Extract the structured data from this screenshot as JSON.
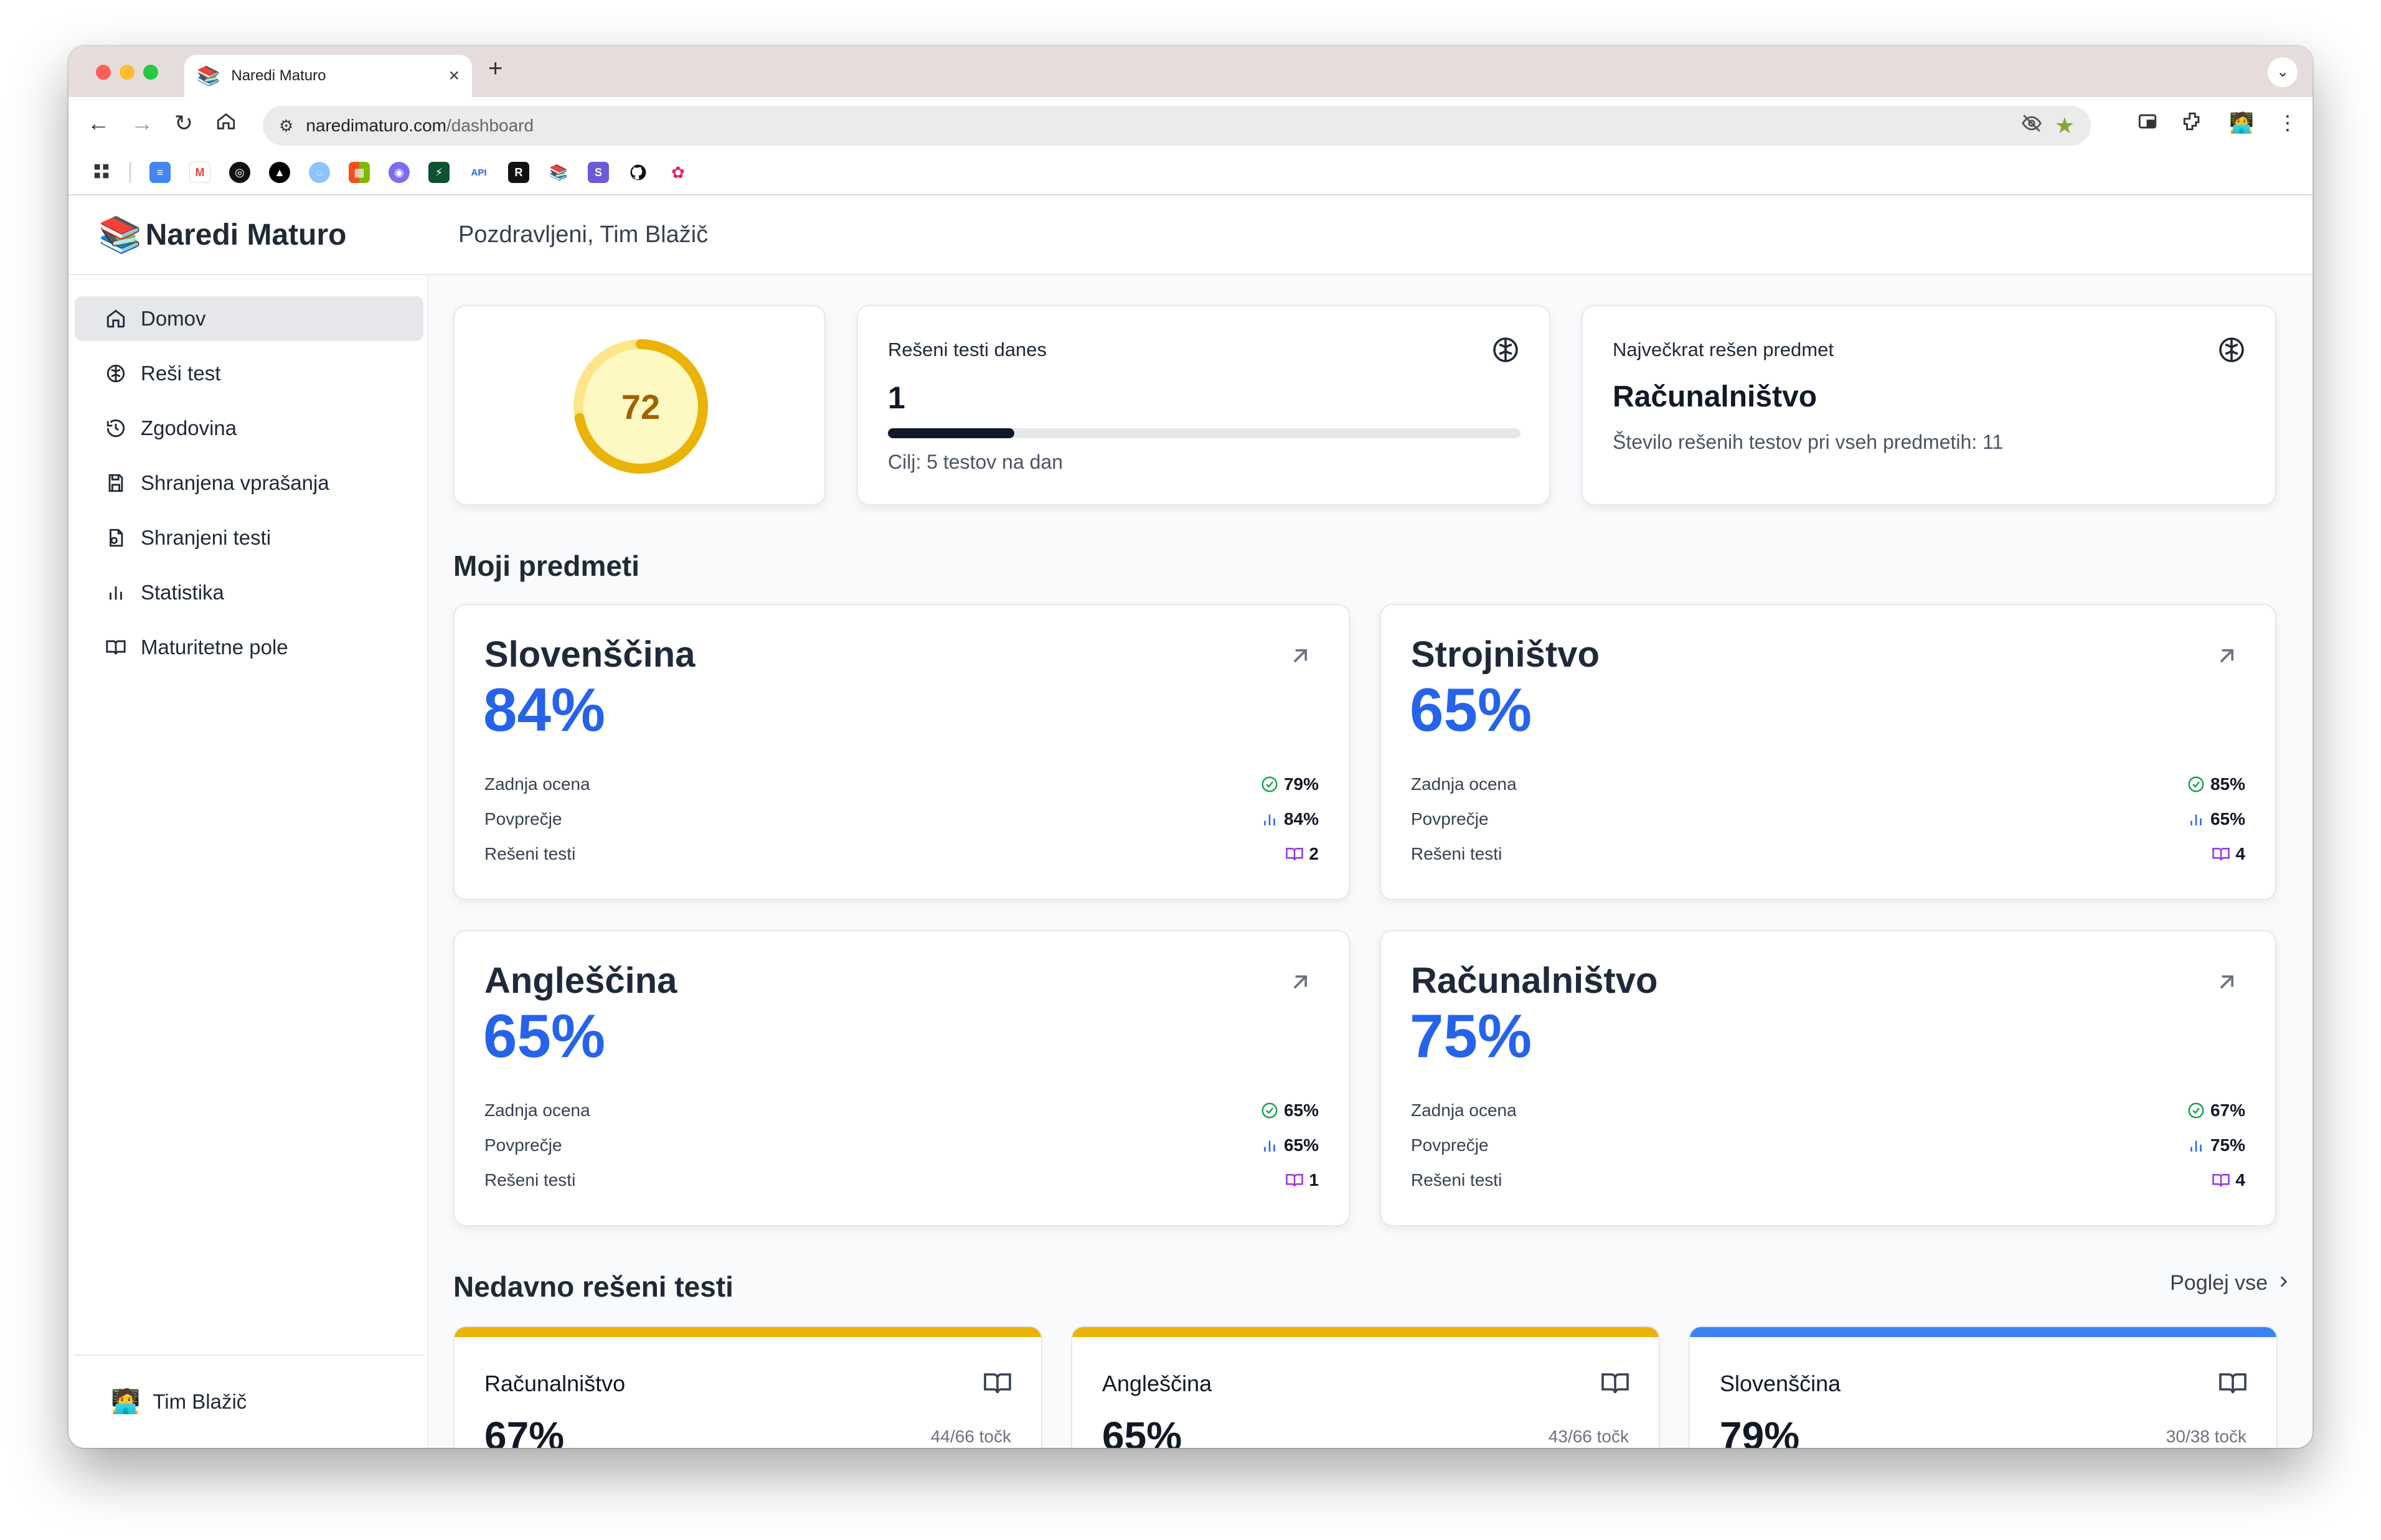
{
  "browser": {
    "tab_title": "Naredi Maturo",
    "tab_favicon": "📚",
    "url_domain": "naredimaturo.com",
    "url_path": "/dashboard"
  },
  "app": {
    "brand": "Naredi Maturo",
    "greeting": "Pozdravljeni, Tim Blažič"
  },
  "sidebar": {
    "items": [
      {
        "label": "Domov",
        "icon": "home-icon"
      },
      {
        "label": "Reši test",
        "icon": "brain-icon"
      },
      {
        "label": "Zgodovina",
        "icon": "history-icon"
      },
      {
        "label": "Shranjena vprašanja",
        "icon": "save-icon"
      },
      {
        "label": "Shranjeni testi",
        "icon": "file-icon"
      },
      {
        "label": "Statistika",
        "icon": "bar-chart-icon"
      },
      {
        "label": "Maturitetne pole",
        "icon": "book-icon"
      }
    ],
    "user": "Tim Blažič"
  },
  "stats": {
    "score": "72",
    "score_fraction": 0.72,
    "solved_today_label": "Rešeni testi danes",
    "solved_today_value": "1",
    "solved_today_progress": 0.2,
    "goal_text": "Cilj: 5 testov na dan",
    "top_subject_label": "Največkrat rešen predmet",
    "top_subject_value": "Računalništvo",
    "top_subject_sub": "Število rešenih testov pri vseh predmetih: 11"
  },
  "subjects_title": "Moji predmeti",
  "row_labels": {
    "last": "Zadnja ocena",
    "avg": "Povprečje",
    "solved": "Rešeni testi"
  },
  "subjects": [
    {
      "name": "Slovenščina",
      "pct": "84%",
      "last": "79%",
      "avg": "84%",
      "solved": "2"
    },
    {
      "name": "Strojništvo",
      "pct": "65%",
      "last": "85%",
      "avg": "65%",
      "solved": "4"
    },
    {
      "name": "Angleščina",
      "pct": "65%",
      "last": "65%",
      "avg": "65%",
      "solved": "1"
    },
    {
      "name": "Računalništvo",
      "pct": "75%",
      "last": "67%",
      "avg": "75%",
      "solved": "4"
    }
  ],
  "recent_title": "Nedavno rešeni testi",
  "view_all": "Poglej vse",
  "recent": [
    {
      "name": "Računalništvo",
      "pct": "67%",
      "points": "44/66 točk",
      "color": "#eab308"
    },
    {
      "name": "Angleščina",
      "pct": "65%",
      "points": "43/66 točk",
      "color": "#eab308"
    },
    {
      "name": "Slovenščina",
      "pct": "79%",
      "points": "30/38 točk",
      "color": "#3b82f6"
    }
  ],
  "colors": {
    "accent_blue": "#2563eb",
    "score_ring": "#eab308",
    "check_green": "#16a34a",
    "book_purple": "#9333ea"
  }
}
